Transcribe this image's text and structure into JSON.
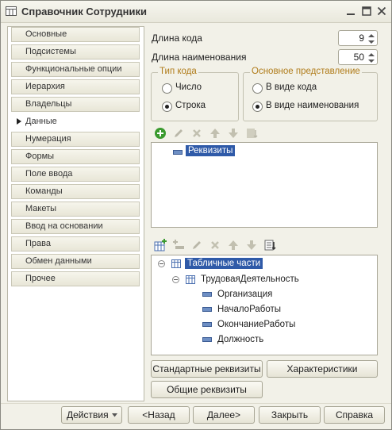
{
  "window": {
    "title": "Справочник Сотрудники",
    "controls": [
      "minimize-icon",
      "maximize-icon",
      "close-icon"
    ]
  },
  "sidebar": {
    "items": [
      {
        "label": "Основные",
        "active": false
      },
      {
        "label": "Подсистемы",
        "active": false
      },
      {
        "label": "Функциональные опции",
        "active": false
      },
      {
        "label": "Иерархия",
        "active": false
      },
      {
        "label": "Владельцы",
        "active": false
      },
      {
        "label": "Данные",
        "active": true
      },
      {
        "label": "Нумерация",
        "active": false
      },
      {
        "label": "Формы",
        "active": false
      },
      {
        "label": "Поле ввода",
        "active": false
      },
      {
        "label": "Команды",
        "active": false
      },
      {
        "label": "Макеты",
        "active": false
      },
      {
        "label": "Ввод на основании",
        "active": false
      },
      {
        "label": "Права",
        "active": false
      },
      {
        "label": "Обмен данными",
        "active": false
      },
      {
        "label": "Прочее",
        "active": false
      }
    ]
  },
  "fields": {
    "code_length_label": "Длина кода",
    "code_length_value": "9",
    "name_length_label": "Длина наименования",
    "name_length_value": "50"
  },
  "code_type": {
    "legend": "Тип кода",
    "options": [
      {
        "label": "Число",
        "selected": false
      },
      {
        "label": "Строка",
        "selected": true
      }
    ]
  },
  "main_representation": {
    "legend": "Основное представление",
    "options": [
      {
        "label": "В виде кода",
        "selected": false
      },
      {
        "label": "В виде наименования",
        "selected": true
      }
    ]
  },
  "attributes_tree": {
    "toolbar": [
      "add-icon",
      "edit-icon",
      "delete-icon",
      "move-up-icon",
      "move-down-icon",
      "sort-icon"
    ],
    "root": "Реквизиты"
  },
  "tabular_tree": {
    "toolbar": [
      "add-tabular-icon",
      "add-attribute-icon",
      "edit-icon",
      "delete-icon",
      "move-up-icon",
      "move-down-icon",
      "sort-icon"
    ],
    "root": "Табличные части",
    "table": "ТрудоваяДеятельность",
    "fields": [
      "Организация",
      "НачалоРаботы",
      "ОкончаниеРаботы",
      "Должность"
    ]
  },
  "buttons": {
    "standard_attributes": "Стандартные реквизиты",
    "characteristics": "Характеристики",
    "common_attributes": "Общие реквизиты"
  },
  "footer": {
    "actions": "Действия",
    "back": "<Назад",
    "next": "Далее>",
    "close": "Закрыть",
    "help": "Справка"
  },
  "colors": {
    "selection": "#2f5aa8",
    "legend_text": "#b07c1a",
    "window_bg": "#f2f1e8"
  }
}
